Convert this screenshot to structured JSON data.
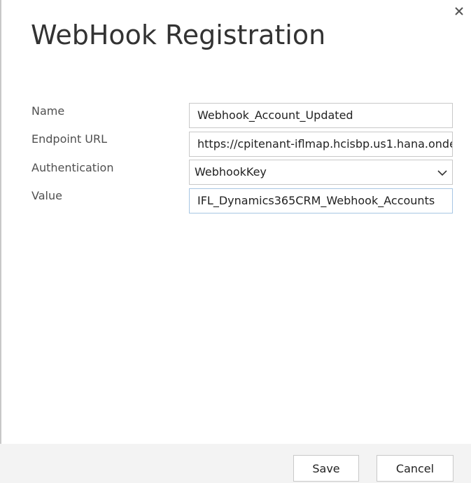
{
  "dialog": {
    "title": "WebHook Registration",
    "close_icon": "close-icon"
  },
  "form": {
    "name_label": "Name",
    "name_value": "Webhook_Account_Updated",
    "endpoint_label": "Endpoint URL",
    "endpoint_value": "https://cpitenant-iflmap.hcisbp.us1.hana.onde",
    "auth_label": "Authentication",
    "auth_value": "WebhookKey",
    "auth_icon": "chevron-down-icon",
    "value_label": "Value",
    "value_value": "IFL_Dynamics365CRM_Webhook_Accounts"
  },
  "footer": {
    "save_label": "Save",
    "cancel_label": "Cancel"
  },
  "colors": {
    "title_text": "#333333",
    "label_text": "#505050",
    "border": "#c8c8c8",
    "focus_border": "#a7c6e3",
    "footer_bg": "#f3f3f3"
  }
}
